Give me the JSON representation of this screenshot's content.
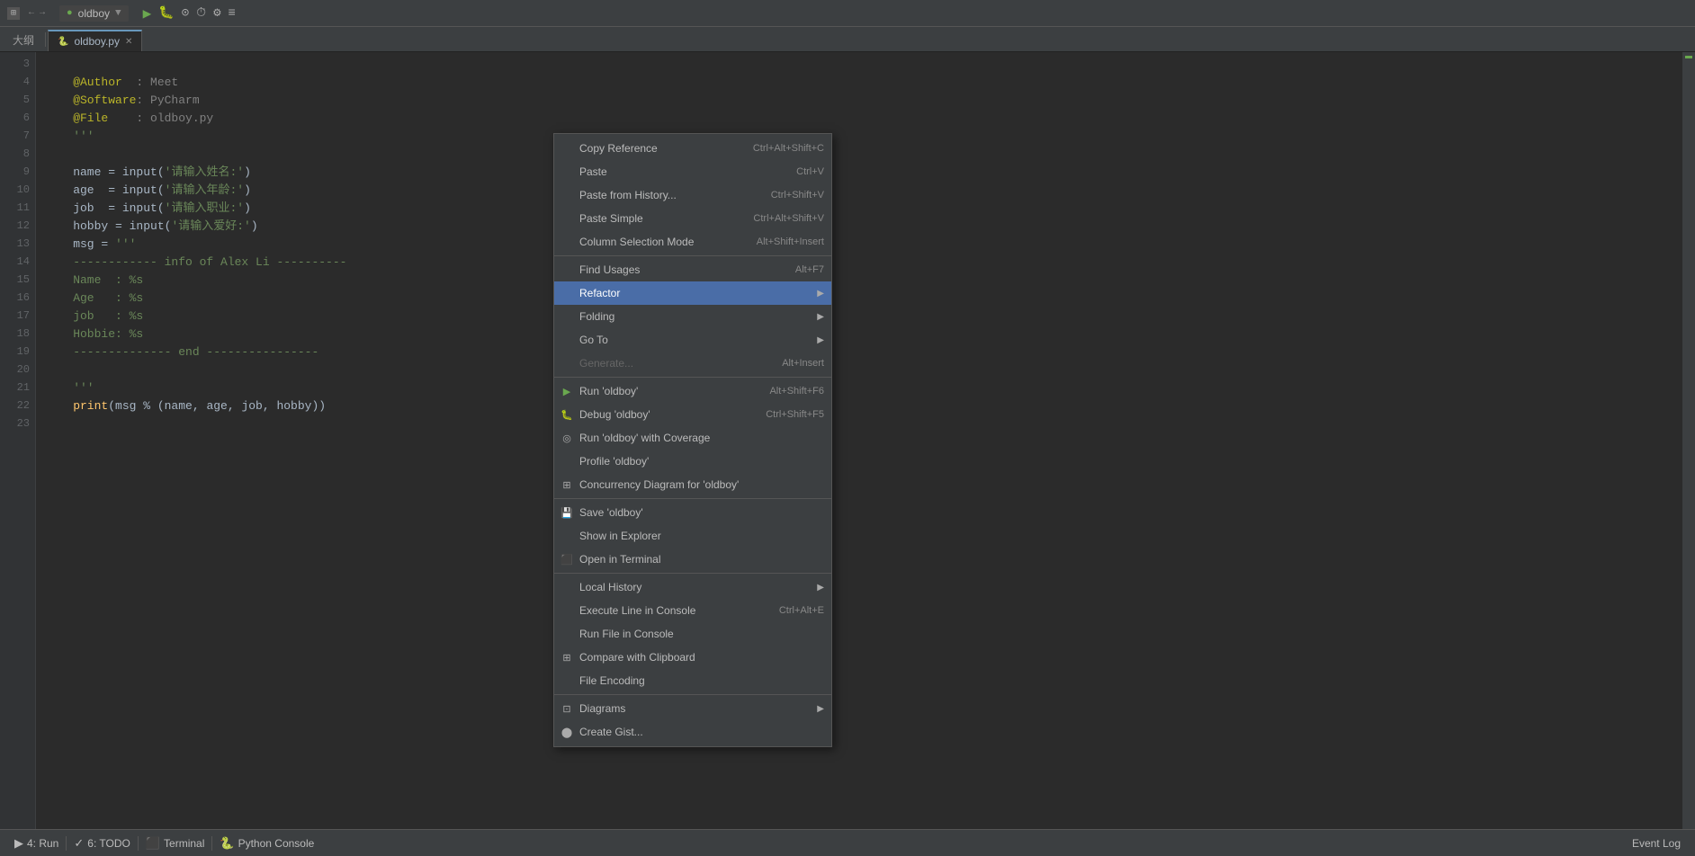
{
  "titlebar": {
    "title": "oldboy",
    "file": "oldboy.py"
  },
  "tabs": {
    "breadcrumb": "大纲",
    "file_tab": "oldboy.py"
  },
  "code": {
    "lines": [
      {
        "num": 3,
        "content": ""
      },
      {
        "num": 4,
        "content": "  @Author  : Meet"
      },
      {
        "num": 5,
        "content": "  @Software: PyCharm"
      },
      {
        "num": 6,
        "content": "  @File    : oldboy.py"
      },
      {
        "num": 7,
        "content": "  '''"
      },
      {
        "num": 8,
        "content": ""
      },
      {
        "num": 9,
        "content": "  name = input('请输入姓名:')"
      },
      {
        "num": 10,
        "content": "  age  = input('请输入年龄:')"
      },
      {
        "num": 11,
        "content": "  job  = input('请输入职业:')"
      },
      {
        "num": 12,
        "content": "  hobby = input('请输入爱好:')"
      },
      {
        "num": 13,
        "content": "  msg = '''"
      },
      {
        "num": 14,
        "content": "  ------------ info of Alex Li ----------"
      },
      {
        "num": 15,
        "content": "  Name  : %s"
      },
      {
        "num": 16,
        "content": "  Age   : %s"
      },
      {
        "num": 17,
        "content": "  job   : %s"
      },
      {
        "num": 18,
        "content": "  Hobbie: %s"
      },
      {
        "num": 19,
        "content": "  -------------- end ----------------"
      },
      {
        "num": 20,
        "content": ""
      },
      {
        "num": 21,
        "content": "  '''"
      },
      {
        "num": 22,
        "content": "  print(msg % (name, age, job, hobby))"
      },
      {
        "num": 23,
        "content": ""
      }
    ]
  },
  "context_menu": {
    "items": [
      {
        "id": "copy-reference",
        "label": "Copy Reference",
        "shortcut": "Ctrl+Alt+Shift+C",
        "icon": "",
        "has_arrow": false,
        "separator_after": false,
        "disabled": false
      },
      {
        "id": "paste",
        "label": "Paste",
        "shortcut": "Ctrl+V",
        "icon": "",
        "has_arrow": false,
        "separator_after": false,
        "disabled": false
      },
      {
        "id": "paste-from-history",
        "label": "Paste from History...",
        "shortcut": "Ctrl+Shift+V",
        "icon": "",
        "has_arrow": false,
        "separator_after": false,
        "disabled": false
      },
      {
        "id": "paste-simple",
        "label": "Paste Simple",
        "shortcut": "Ctrl+Alt+Shift+V",
        "icon": "",
        "has_arrow": false,
        "separator_after": false,
        "disabled": false
      },
      {
        "id": "column-selection-mode",
        "label": "Column Selection Mode",
        "shortcut": "Alt+Shift+Insert",
        "icon": "",
        "has_arrow": false,
        "separator_after": true,
        "disabled": false
      },
      {
        "id": "find-usages",
        "label": "Find Usages",
        "shortcut": "Alt+F7",
        "icon": "",
        "has_arrow": false,
        "separator_after": false,
        "disabled": false
      },
      {
        "id": "refactor",
        "label": "Refactor",
        "shortcut": "",
        "icon": "",
        "has_arrow": true,
        "separator_after": false,
        "disabled": false,
        "highlighted": true
      },
      {
        "id": "folding",
        "label": "Folding",
        "shortcut": "",
        "icon": "",
        "has_arrow": true,
        "separator_after": false,
        "disabled": false
      },
      {
        "id": "go-to",
        "label": "Go To",
        "shortcut": "",
        "icon": "",
        "has_arrow": true,
        "separator_after": false,
        "disabled": false
      },
      {
        "id": "generate",
        "label": "Generate...",
        "shortcut": "Alt+Insert",
        "icon": "",
        "has_arrow": false,
        "separator_after": true,
        "disabled": true
      },
      {
        "id": "run-oldboy",
        "label": "Run 'oldboy'",
        "shortcut": "Alt+Shift+F6",
        "icon": "▶",
        "has_arrow": false,
        "separator_after": false,
        "disabled": false
      },
      {
        "id": "debug-oldboy",
        "label": "Debug 'oldboy'",
        "shortcut": "Ctrl+Shift+F5",
        "icon": "🐛",
        "has_arrow": false,
        "separator_after": false,
        "disabled": false
      },
      {
        "id": "run-with-coverage",
        "label": "Run 'oldboy' with Coverage",
        "shortcut": "",
        "icon": "◎",
        "has_arrow": false,
        "separator_after": false,
        "disabled": false
      },
      {
        "id": "profile-oldboy",
        "label": "Profile 'oldboy'",
        "shortcut": "",
        "icon": "",
        "has_arrow": false,
        "separator_after": false,
        "disabled": false
      },
      {
        "id": "concurrency-diagram",
        "label": "Concurrency Diagram for 'oldboy'",
        "shortcut": "",
        "icon": "⊞",
        "has_arrow": false,
        "separator_after": true,
        "disabled": false
      },
      {
        "id": "save-oldboy",
        "label": "Save 'oldboy'",
        "shortcut": "",
        "icon": "💾",
        "has_arrow": false,
        "separator_after": false,
        "disabled": false
      },
      {
        "id": "show-in-explorer",
        "label": "Show in Explorer",
        "shortcut": "",
        "icon": "",
        "has_arrow": false,
        "separator_after": false,
        "disabled": false
      },
      {
        "id": "open-in-terminal",
        "label": "Open in Terminal",
        "shortcut": "",
        "icon": "⬛",
        "has_arrow": false,
        "separator_after": true,
        "disabled": false
      },
      {
        "id": "local-history",
        "label": "Local History",
        "shortcut": "",
        "icon": "",
        "has_arrow": true,
        "separator_after": false,
        "disabled": false
      },
      {
        "id": "execute-line",
        "label": "Execute Line in Console",
        "shortcut": "Ctrl+Alt+E",
        "icon": "",
        "has_arrow": false,
        "separator_after": false,
        "disabled": false
      },
      {
        "id": "run-file-console",
        "label": "Run File in Console",
        "shortcut": "",
        "icon": "",
        "has_arrow": false,
        "separator_after": false,
        "disabled": false
      },
      {
        "id": "compare-clipboard",
        "label": "Compare with Clipboard",
        "shortcut": "",
        "icon": "⊞",
        "has_arrow": false,
        "separator_after": false,
        "disabled": false
      },
      {
        "id": "file-encoding",
        "label": "File Encoding",
        "shortcut": "",
        "icon": "",
        "has_arrow": false,
        "separator_after": true,
        "disabled": false
      },
      {
        "id": "diagrams",
        "label": "Diagrams",
        "shortcut": "",
        "icon": "⊡",
        "has_arrow": true,
        "separator_after": false,
        "disabled": false
      },
      {
        "id": "create-gist",
        "label": "Create Gist...",
        "shortcut": "",
        "icon": "⬤",
        "has_arrow": false,
        "separator_after": false,
        "disabled": false
      }
    ]
  },
  "status_bar": {
    "run_label": "4: Run",
    "todo_label": "6: TODO",
    "terminal_label": "Terminal",
    "python_console_label": "Python Console",
    "event_log_label": "Event Log"
  }
}
